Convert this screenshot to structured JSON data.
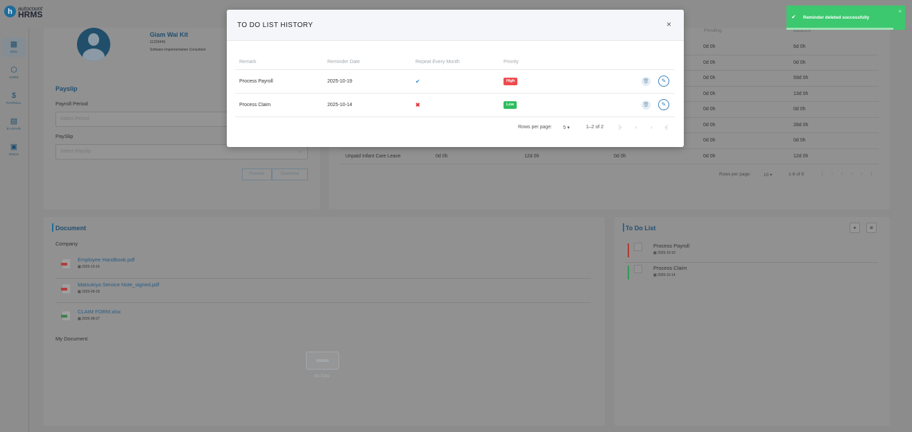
{
  "app": {
    "brand_small": "autocount",
    "brand_large": "HRMS",
    "logo_letter": "h"
  },
  "sidebar": {
    "items": [
      {
        "label": "ESS",
        "icon": "calendar-grid-icon",
        "glyph": "▦"
      },
      {
        "label": "CORE",
        "icon": "cube-icon",
        "glyph": "⬡"
      },
      {
        "label": "PAYROLL",
        "icon": "dollar-coin-icon",
        "glyph": "$"
      },
      {
        "label": "E-LEAVE",
        "icon": "calendar-icon",
        "glyph": "▤"
      },
      {
        "label": "DOCS",
        "icon": "document-folder-icon",
        "glyph": "▣"
      }
    ]
  },
  "profile": {
    "name": "Giam Wai Kit",
    "id": "1123344S",
    "position": "Software Implementation Consultant"
  },
  "payslip": {
    "title": "Payslip",
    "period_label": "Payroll Period",
    "period_placeholder": "Select Period",
    "payslip_label": "PaySlip",
    "payslip_placeholder": "Select Payslip",
    "preview_label": "Preview",
    "download_label": "Download"
  },
  "leave": {
    "headers": {
      "pending": "Pending",
      "balance": "Balance"
    },
    "rows": [
      {
        "type": "",
        "entitled": "",
        "taken": "",
        "adjust": "",
        "pending": "0d 0h",
        "balance": "6d 0h"
      },
      {
        "type": "",
        "entitled": "",
        "taken": "",
        "adjust": "",
        "pending": "0d 0h",
        "balance": "0d 0h"
      },
      {
        "type": "",
        "entitled": "",
        "taken": "",
        "adjust": "",
        "pending": "0d 0h",
        "balance": "59d 0h"
      },
      {
        "type": "",
        "entitled": "",
        "taken": "",
        "adjust": "",
        "pending": "0d 0h",
        "balance": "13d 0h"
      },
      {
        "type": "",
        "entitled": "",
        "taken": "",
        "adjust": "",
        "pending": "0d 0h",
        "balance": "0d 0h"
      },
      {
        "type": "",
        "entitled": "",
        "taken": "",
        "adjust": "",
        "pending": "0d 0h",
        "balance": "28d 0h"
      },
      {
        "type": "",
        "entitled": "",
        "taken": "",
        "adjust": "",
        "pending": "0d 0h",
        "balance": "0d 0h"
      },
      {
        "type": "Unpaid Infant Care Leave",
        "entitled": "0d 0h",
        "taken": "12d 0h",
        "adjust": "0d 0h",
        "pending": "0d 0h",
        "balance": "12d 0h"
      }
    ],
    "pager": {
      "rows_label": "Rows per page:",
      "rows_value": "10",
      "range": "1-8 of 8"
    }
  },
  "documents": {
    "title": "Document",
    "company_label": "Company",
    "company_items": [
      {
        "name": "Employee Handbook.pdf",
        "date": "2025-10-16",
        "kind": "pdf"
      },
      {
        "name": "Matsukiyo Service Note_signed.pdf",
        "date": "2025-09-18",
        "kind": "pdf"
      },
      {
        "name": "CLAIM FORM.xlsx",
        "date": "2025-08-27",
        "kind": "xlsx"
      }
    ],
    "my_label": "My Document",
    "no_data": "No Data"
  },
  "todo": {
    "title": "To Do List",
    "add_glyph": "+",
    "history_glyph": "≡",
    "items": [
      {
        "title": "Process Payroll",
        "date": "2025-10-19",
        "color": "#c0392b"
      },
      {
        "title": "Process Claim",
        "date": "2025-10-14",
        "color": "#27ae60"
      }
    ]
  },
  "toast": {
    "message": "Reminder deleted successfully",
    "tick": "✔",
    "close": "×"
  },
  "modal": {
    "title": "TO DO LIST HISTORY",
    "close": "×",
    "columns": {
      "remark": "Remark",
      "date": "Reminder Date",
      "repeat": "Repeat Every Month",
      "priority": "Priority"
    },
    "rows": [
      {
        "remark": "Process Payroll",
        "date": "2025-10-19",
        "repeat": "✔",
        "priority": "High",
        "priority_color": "#ee4b4f"
      },
      {
        "remark": "Process Claim",
        "date": "2025-10-14",
        "repeat": "✖",
        "priority": "Low",
        "priority_color": "#2ebd5f"
      }
    ],
    "pager": {
      "rows_label": "Rows per page:",
      "rows_value": "5",
      "range": "1–2 of 2"
    }
  },
  "colors": {
    "brand": "#1e6c9c",
    "success": "#3cc86f",
    "high": "#ee4b4f",
    "low": "#2ebd5f"
  }
}
